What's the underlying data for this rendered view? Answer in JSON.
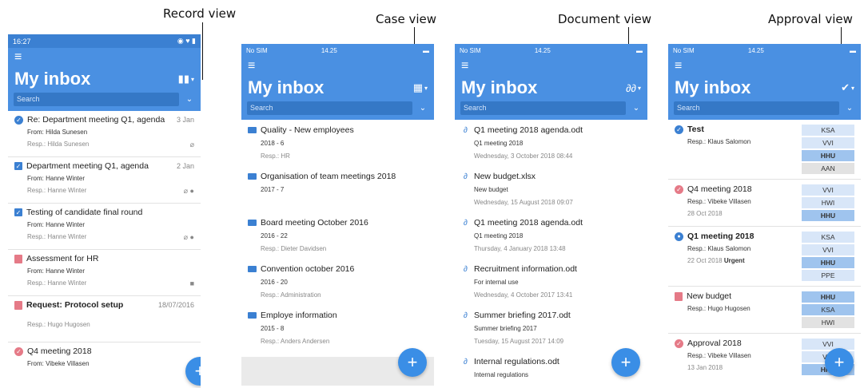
{
  "captions": {
    "record": "Record view",
    "case": "Case view",
    "document": "Document view",
    "approval": "Approval view"
  },
  "common": {
    "title": "My inbox",
    "search_placeholder": "Search",
    "menu_icon": "hamburger-icon",
    "fab_label": "+",
    "accent": "#4a90e2"
  },
  "record_view": {
    "status_time": "16:27",
    "items": [
      {
        "name": "Re: Department meeting Q1, agenda",
        "date": "3 Jan",
        "from": "From: Hilda Sunesen",
        "resp": "Resp.: Hilda Sunesen",
        "icon": "check-circle-icon",
        "bold": false
      },
      {
        "name": "Department meeting Q1, agenda",
        "date": "2 Jan",
        "from": "From: Hanne Winter",
        "resp": "Resp.: Hanne Winter",
        "icon": "checkbox-icon",
        "bold": false
      },
      {
        "name": "Testing of candidate final round",
        "date": "",
        "from": "From: Hanne Winter",
        "resp": "Resp.: Hanne Winter",
        "icon": "checkbox-icon",
        "bold": false
      },
      {
        "name": "Assessment for HR",
        "date": "",
        "from": "From: Hanne Winter",
        "resp": "Resp.: Hanne Winter",
        "icon": "red-doc-icon",
        "bold": false
      },
      {
        "name": "Request: Protocol setup",
        "date": "18/07/2016",
        "from": "",
        "resp": "Resp.: Hugo Hugosen",
        "icon": "red-doc-icon",
        "bold": true
      },
      {
        "name": "Q4 meeting 2018",
        "date": "",
        "from": "From: Vibeke Villasen",
        "resp": "",
        "icon": "red-check-icon",
        "bold": false
      }
    ]
  },
  "case_view": {
    "status_carrier": "No SIM",
    "status_time": "14.25",
    "items": [
      {
        "name": "Quality - New employees",
        "num": "2018 - 6",
        "resp": "Resp.: HR"
      },
      {
        "name": "Organisation of team meetings 2018",
        "num": "2017 - 7",
        "resp": ""
      },
      {
        "name": "Board meeting October 2016",
        "num": "2016 - 22",
        "resp": "Resp.: Dieter Davidsen"
      },
      {
        "name": "Convention october 2016",
        "num": "2016 - 20",
        "resp": "Resp.: Administration"
      },
      {
        "name": "Employe information",
        "num": "2015 - 8",
        "resp": "Resp.: Anders Andersen"
      }
    ]
  },
  "document_view": {
    "status_carrier": "No SIM",
    "status_time": "14.25",
    "items": [
      {
        "name": "Q1 meeting 2018 agenda.odt",
        "sub": "Q1 meeting 2018",
        "date": "Wednesday, 3 October 2018 08:44"
      },
      {
        "name": "New budget.xlsx",
        "sub": "New budget",
        "date": "Wednesday, 15 August 2018 09:07"
      },
      {
        "name": "Q1 meeting 2018 agenda.odt",
        "sub": "Q1 meeting 2018",
        "date": "Thursday, 4 January 2018 13:48"
      },
      {
        "name": "Recruitment information.odt",
        "sub": "For internal use",
        "date": "Wednesday, 4 October 2017 13:41"
      },
      {
        "name": "Summer briefing 2017.odt",
        "sub": "Summer briefing 2017",
        "date": "Tuesday, 15 August 2017 14:09"
      },
      {
        "name": "Internal regulations.odt",
        "sub": "Internal regulations",
        "date": ""
      }
    ]
  },
  "approval_view": {
    "status_carrier": "No SIM",
    "status_time": "14.25",
    "items": [
      {
        "name": "Test",
        "resp": "Resp.: Klaus Salomon",
        "date": "",
        "urgent": "",
        "bold": true,
        "chips": [
          "KSA",
          "VVI",
          "HHU",
          "AAN"
        ]
      },
      {
        "name": "Q4 meeting 2018",
        "resp": "Resp.: Vibeke Villasen",
        "date": "28 Oct 2018",
        "urgent": "",
        "bold": false,
        "chips": [
          "VVI",
          "HWI",
          "HHU"
        ]
      },
      {
        "name": "Q1 meeting 2018",
        "resp": "Resp.: Klaus Salomon",
        "date": "22 Oct 2018",
        "urgent": "Urgent",
        "bold": true,
        "chips": [
          "KSA",
          "VVI",
          "HHU",
          "PPE"
        ]
      },
      {
        "name": "New budget",
        "resp": "Resp.: Hugo Hugosen",
        "date": "",
        "urgent": "",
        "bold": false,
        "chips": [
          "HHU",
          "KSA",
          "HWI"
        ]
      },
      {
        "name": "Approval 2018",
        "resp": "Resp.: Vibeke Villasen",
        "date": "13 Jan 2018",
        "urgent": "",
        "bold": false,
        "chips": [
          "VVI",
          "VVI",
          "HHU"
        ]
      }
    ]
  }
}
